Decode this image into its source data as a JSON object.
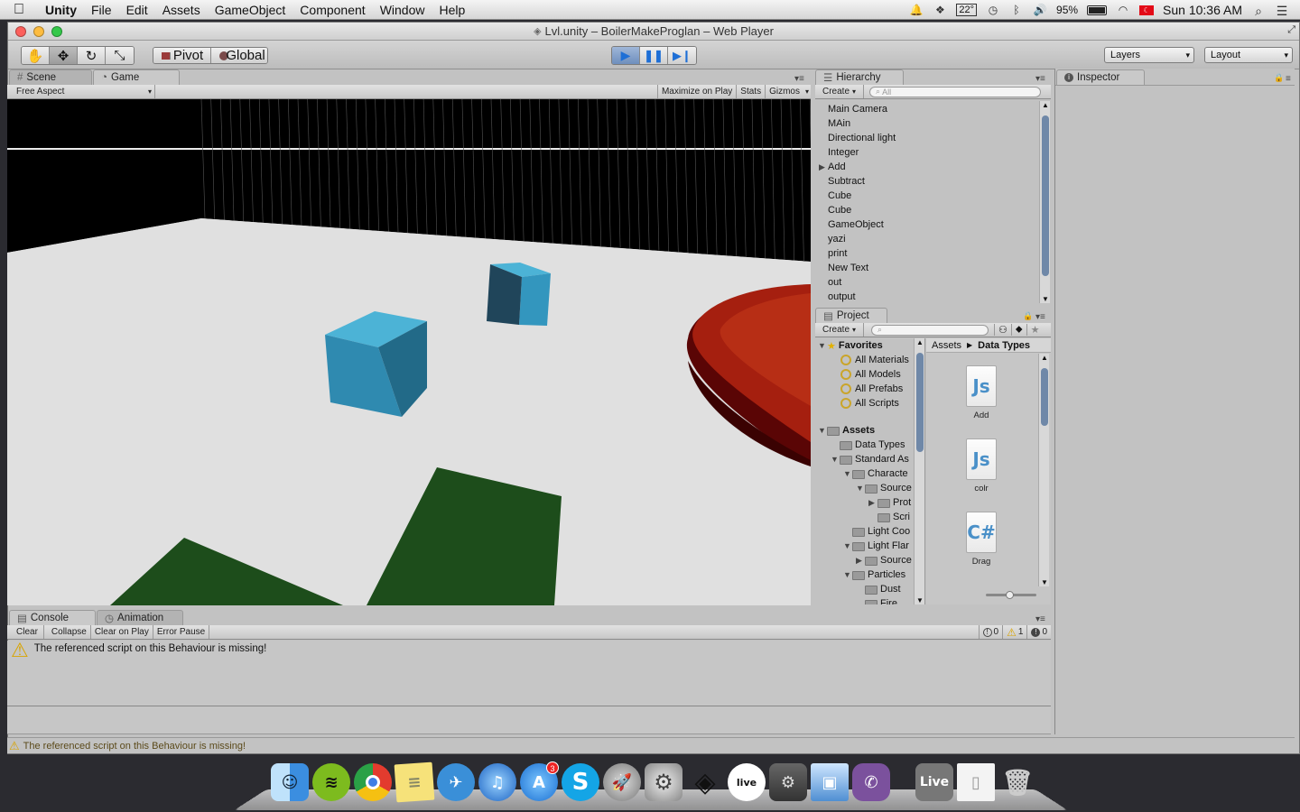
{
  "menubar": {
    "app": "Unity",
    "items": [
      "File",
      "Edit",
      "Assets",
      "GameObject",
      "Component",
      "Window",
      "Help"
    ],
    "temperature": "22°",
    "battery": "95%",
    "clock": "Sun 10:36 AM"
  },
  "window": {
    "title": "Lvl.unity – BoilerMakeProglan – Web Player"
  },
  "toolbar": {
    "pivot": "Pivot",
    "global": "Global",
    "layers": "Layers",
    "layout": "Layout"
  },
  "game_panel": {
    "tabs": [
      "Scene",
      "Game"
    ],
    "aspect": "Free Aspect",
    "maximize": "Maximize on Play",
    "stats": "Stats",
    "gizmos": "Gizmos"
  },
  "hierarchy": {
    "title": "Hierarchy",
    "create": "Create",
    "search_placeholder": "All",
    "items": [
      "Main Camera",
      "MAin",
      "Directional light",
      "Integer",
      "Add",
      "Subtract",
      "Cube",
      "Cube",
      "GameObject",
      "yazi",
      "print",
      "New Text",
      "out",
      "output"
    ]
  },
  "project": {
    "title": "Project",
    "create": "Create",
    "favorites_label": "Favorites",
    "favorites": [
      "All Materials",
      "All Models",
      "All Prefabs",
      "All Scripts"
    ],
    "assets_label": "Assets",
    "tree": [
      "Data Types",
      "Standard As",
      "Characte",
      "Source",
      "Prot",
      "Scri",
      "Light Coo",
      "Light Flar",
      "Source",
      "Particles",
      "Dust",
      "Fire"
    ],
    "breadcrumb": [
      "Assets",
      "Data Types"
    ],
    "assets": [
      {
        "name": "Add",
        "kind": "Js"
      },
      {
        "name": "colr",
        "kind": "Js"
      },
      {
        "name": "Drag",
        "kind": "C#"
      }
    ]
  },
  "inspector": {
    "title": "Inspector"
  },
  "console": {
    "tabs": [
      "Console",
      "Animation"
    ],
    "buttons": [
      "Clear",
      "Collapse",
      "Clear on Play",
      "Error Pause"
    ],
    "log_count": "0",
    "warn_count": "1",
    "error_count": "0",
    "message": "The referenced script on this Behaviour is missing!",
    "status": "The referenced script on this Behaviour is missing!"
  },
  "dock": {
    "badge": "3",
    "live_label": "Live"
  }
}
